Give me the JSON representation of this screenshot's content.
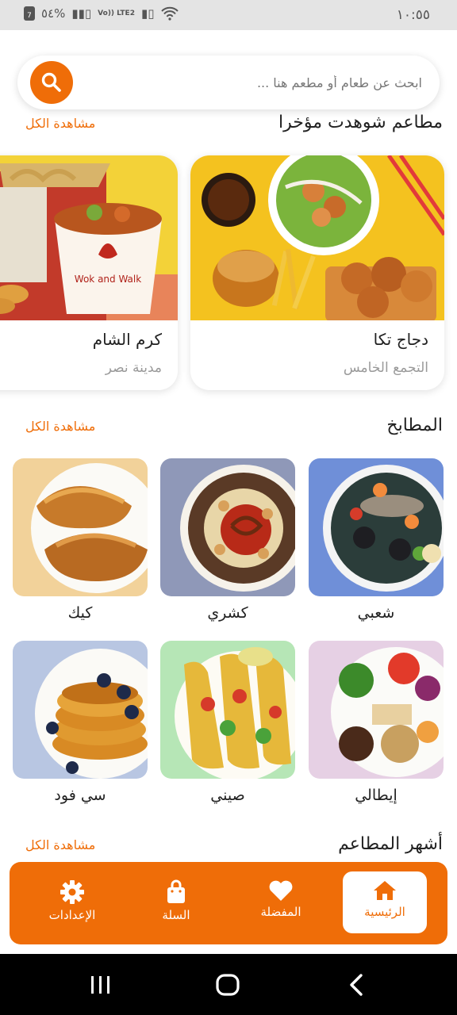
{
  "status_bar": {
    "time": "١٠:٥٥",
    "battery": "٥٤%",
    "battery_digit": "7",
    "network": "Vo)) LTE2"
  },
  "search": {
    "placeholder": "ابحث عن طعام أو مطعم هنا ..."
  },
  "recent": {
    "title": "مطاعم شوهدت مؤخرا",
    "see_all": "مشاهدة الكل",
    "items": [
      {
        "name": "دجاج تكا",
        "location": "التجمع الخامس",
        "image": "fried-chicken-burger-salad-photo"
      },
      {
        "name": "كرم الشام",
        "location": "مدينة نصر",
        "image": "noodle-box-wok-and-walk-photo",
        "brand_text": "Wok and Walk"
      }
    ]
  },
  "cuisines": {
    "title": "المطابخ",
    "see_all": "مشاهدة الكل",
    "items": [
      {
        "label": "شعبي",
        "image": "seafood-plate-photo"
      },
      {
        "label": "كشري",
        "image": "koshari-plate-photo"
      },
      {
        "label": "كيك",
        "image": "croissants-photo"
      },
      {
        "label": "إيطالي",
        "image": "healthy-platter-photo"
      },
      {
        "label": "صيني",
        "image": "tacos-photo"
      },
      {
        "label": "سي فود",
        "image": "pancakes-photo"
      }
    ]
  },
  "popular": {
    "title": "أشهر المطاعم",
    "see_all": "مشاهدة الكل"
  },
  "bottom_nav": {
    "active": "home",
    "items": [
      {
        "id": "home",
        "label": "الرئيسية",
        "icon": "home-icon"
      },
      {
        "id": "favorites",
        "label": "المفضلة",
        "icon": "heart-icon"
      },
      {
        "id": "cart",
        "label": "السلة",
        "icon": "shopping-bag-icon"
      },
      {
        "id": "settings",
        "label": "الإعدادات",
        "icon": "gear-icon"
      }
    ]
  },
  "colors": {
    "accent": "#ef6d08",
    "status_bar": "#e4e4e4"
  }
}
